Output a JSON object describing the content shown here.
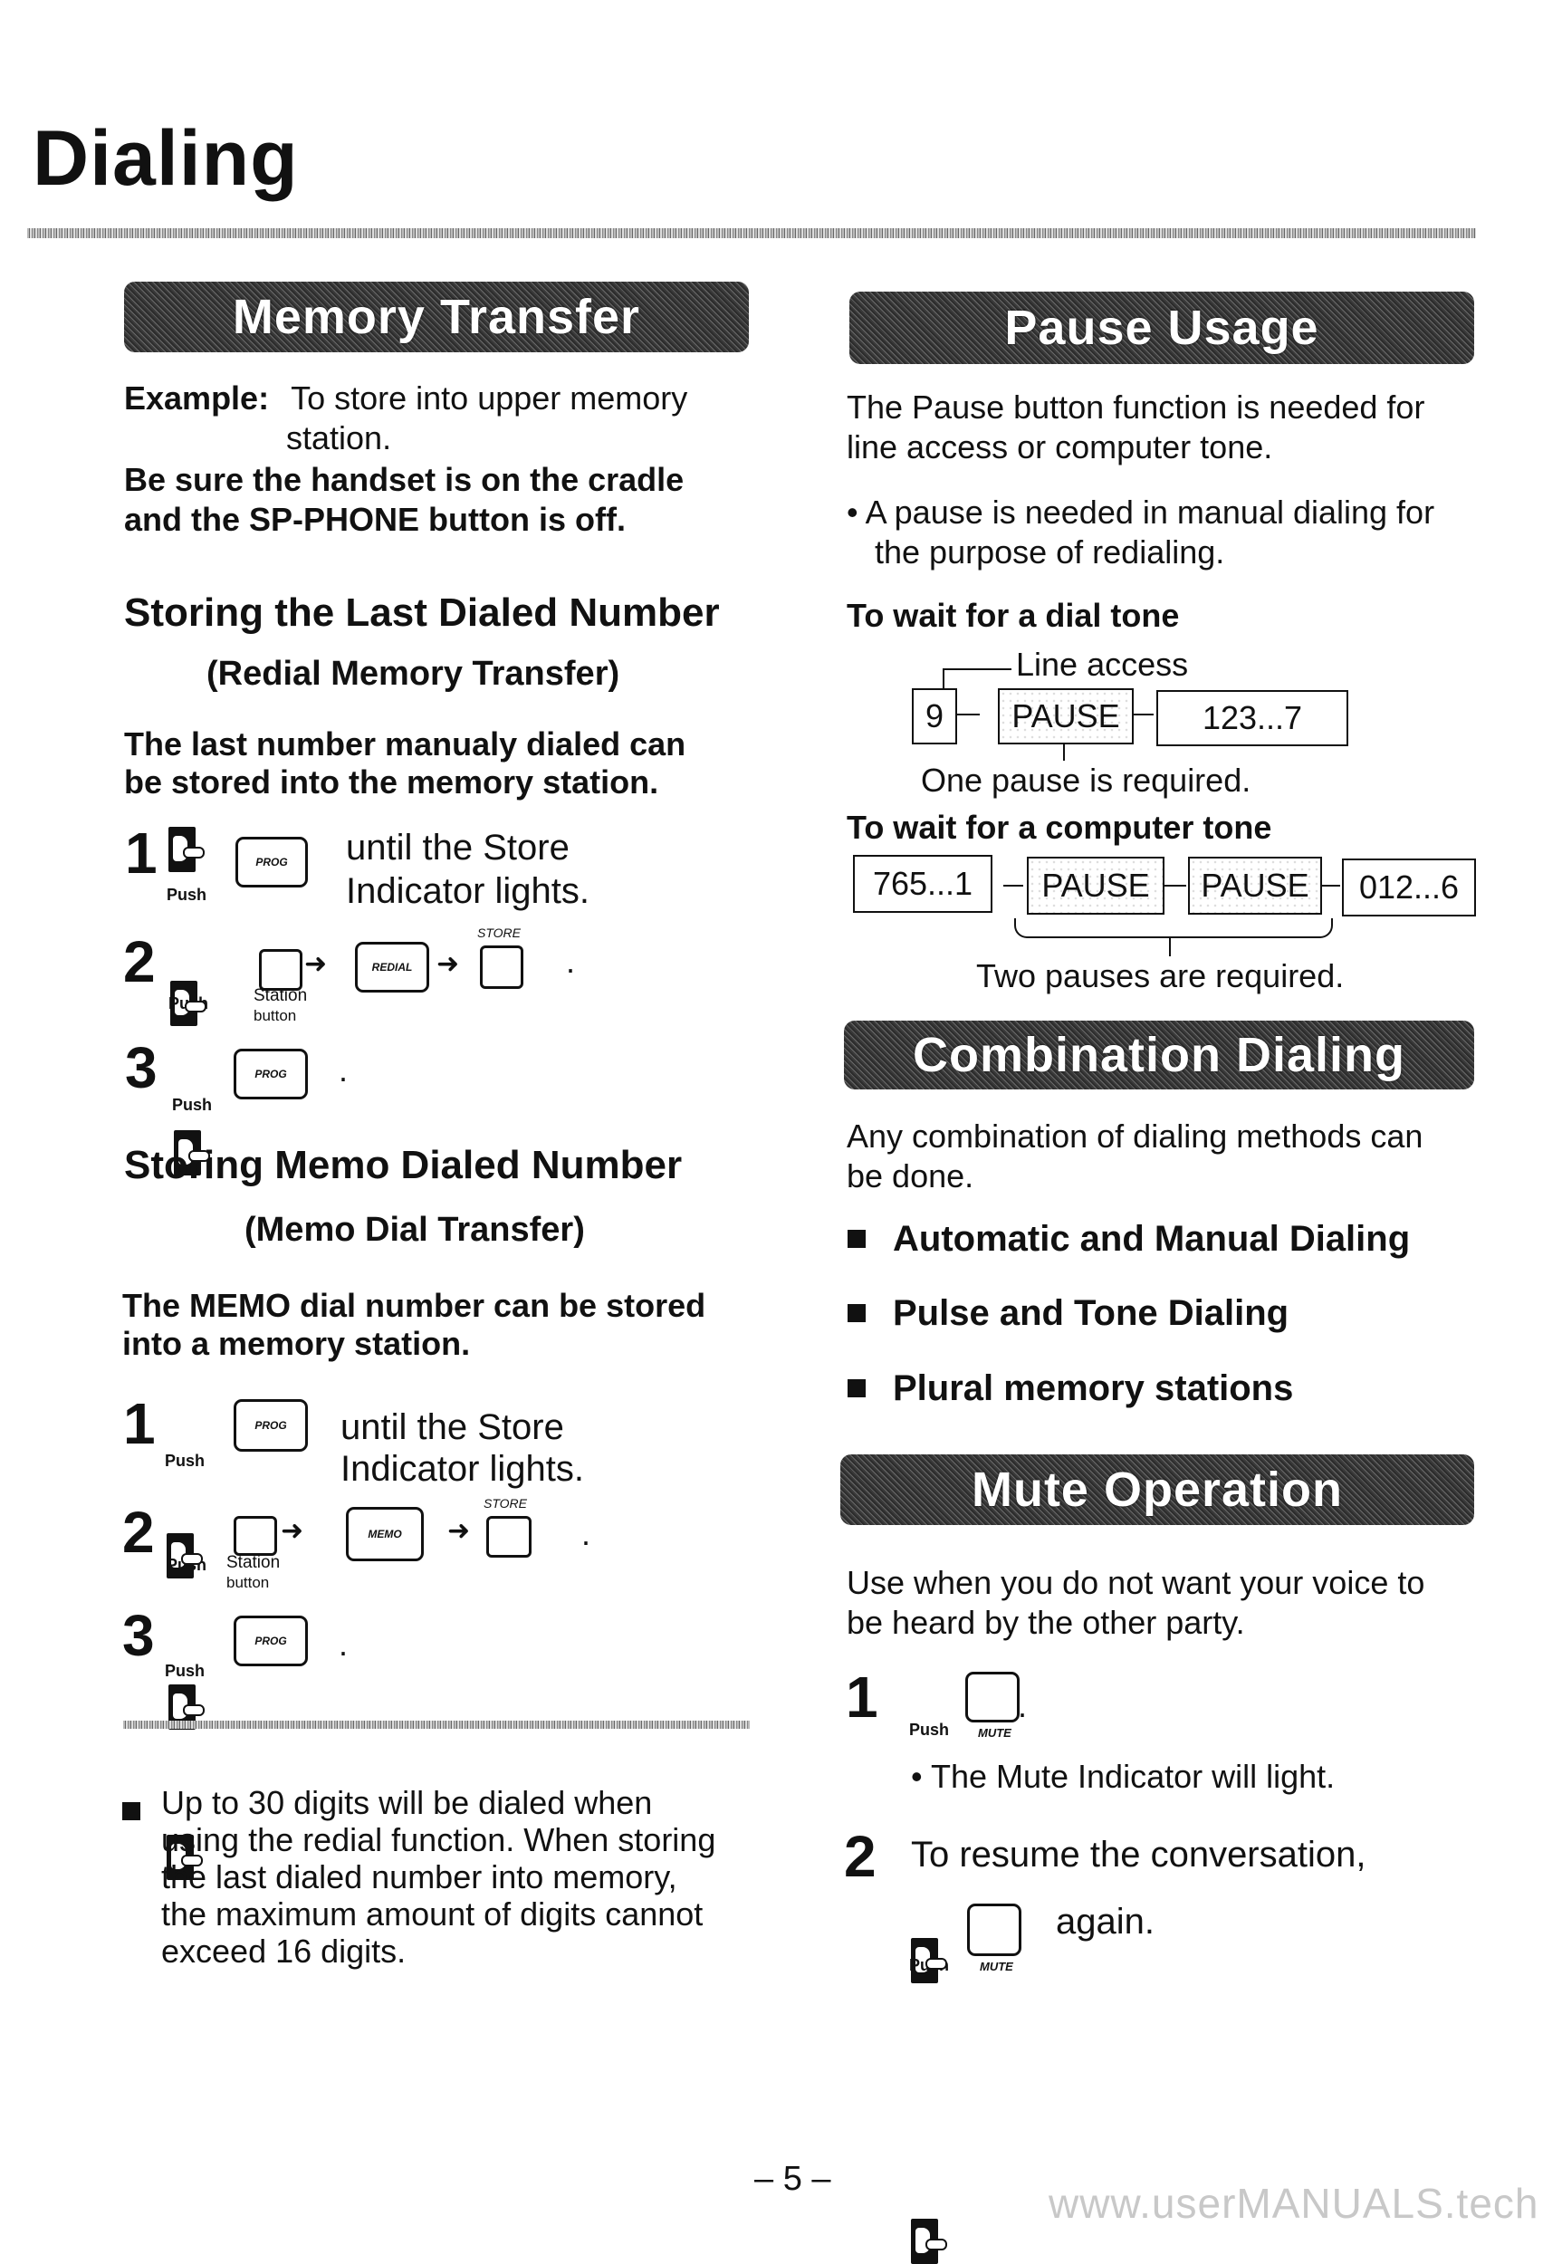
{
  "page": {
    "title": "Dialing",
    "page_number": "– 5 –",
    "watermark": "www.userMANUALS.tech"
  },
  "memory_transfer": {
    "header": "Memory Transfer",
    "example_label": "Example:",
    "example_text_line1": "To store into upper memory",
    "example_text_line2": "station.",
    "warning_line1": "Be sure the handset is on the cradle",
    "warning_line2": "and the SP-PHONE button is off.",
    "last_dialed": {
      "heading": "Storing the Last Dialed Number",
      "subheading": "(Redial Memory Transfer)",
      "desc_line1": "The last number manualy dialed can",
      "desc_line2": "be stored into the memory station.",
      "steps": [
        {
          "num": "1",
          "push": "Push",
          "key": "PROG",
          "text_line1": "until the Store",
          "text_line2": "Indicator lights."
        },
        {
          "num": "2",
          "push": "Push",
          "station_label_line1": "Station",
          "station_label_line2": "button",
          "key": "REDIAL",
          "store_label": "STORE",
          "end": "."
        },
        {
          "num": "3",
          "push": "Push",
          "key": "PROG",
          "end": "."
        }
      ]
    },
    "memo_dialed": {
      "heading": "Storing Memo Dialed Number",
      "subheading": "(Memo Dial Transfer)",
      "desc_line1": "The MEMO dial number can be stored",
      "desc_line2": "into a memory station.",
      "steps": [
        {
          "num": "1",
          "push": "Push",
          "key": "PROG",
          "text_line1": "until the Store",
          "text_line2": "Indicator lights."
        },
        {
          "num": "2",
          "push": "Push",
          "station_label_line1": "Station",
          "station_label_line2": "button",
          "key": "MEMO",
          "store_label": "STORE",
          "end": "."
        },
        {
          "num": "3",
          "push": "Push",
          "key": "PROG",
          "end": "."
        }
      ]
    },
    "note_lines": [
      "Up to 30 digits will be dialed when",
      "using the redial function. When storing",
      "the last dialed number into memory,",
      "the maximum amount of digits cannot",
      "exceed 16 digits."
    ]
  },
  "pause_usage": {
    "header": "Pause Usage",
    "intro_line1": "The Pause button function is needed for",
    "intro_line2": "line access or computer tone.",
    "bullet_line1": "• A pause is needed in manual dialing for",
    "bullet_line2": "the purpose of redialing.",
    "dial_tone": {
      "heading": "To wait for a dial tone",
      "callout": "Line access",
      "boxes": [
        "9",
        "PAUSE",
        "123...7"
      ],
      "note": "One pause is required."
    },
    "computer_tone": {
      "heading": "To wait for a computer tone",
      "boxes": [
        "765...1",
        "PAUSE",
        "PAUSE",
        "012...6"
      ],
      "note": "Two pauses are required."
    }
  },
  "combination_dialing": {
    "header": "Combination Dialing",
    "intro_line1": "Any combination of dialing methods can",
    "intro_line2": "be done.",
    "items": [
      "Automatic and Manual Dialing",
      "Pulse and Tone Dialing",
      "Plural memory stations"
    ]
  },
  "mute_operation": {
    "header": "Mute Operation",
    "intro_line1": "Use when you do not want your voice to",
    "intro_line2": "be heard by the other party.",
    "step1": {
      "num": "1",
      "push": "Push",
      "key_label": "MUTE",
      "end": ".",
      "note": "• The Mute Indicator will light."
    },
    "step2": {
      "num": "2",
      "text": "To resume the conversation,",
      "push": "Push",
      "key_label": "MUTE",
      "after": "again."
    }
  }
}
